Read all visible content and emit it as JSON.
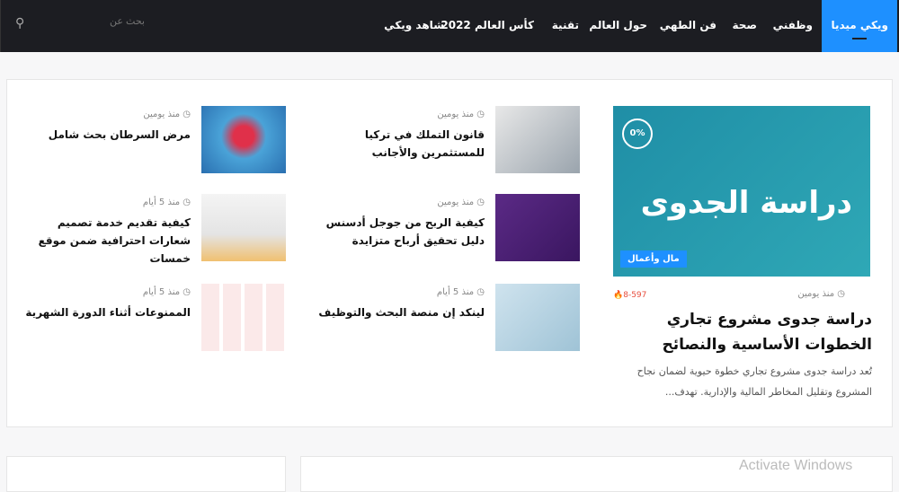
{
  "nav": {
    "items": [
      "ويكي ميديا",
      "وظفني",
      "صحة",
      "فن الطهي",
      "حول العالم",
      "تقنية",
      "كأس العالم 2022",
      "شاهد ويكي"
    ],
    "search_placeholder": "بحث عن"
  },
  "featured": {
    "image_text": "دراسة الجدوى",
    "percent": "0%",
    "category": "مال وأعمال",
    "time": "منذ يومين",
    "views": "8-597",
    "title": "دراسة جدوى مشروع تجاري الخطوات الأساسية والنصائح",
    "excerpt": "تُعد دراسة جدوى مشروع تجاري خطوة حيوية لضمان نجاح المشروع وتقليل المخاطر المالية والإدارية. تهدف..."
  },
  "middle": [
    {
      "time": "منذ يومين",
      "title": "قانون التملك في تركيا للمستثمرين والأجانب"
    },
    {
      "time": "منذ يومين",
      "title": "كيفية الربح من جوجل أدسنس دليل تحقيق أرباح متزايدة"
    },
    {
      "time": "منذ 5 أيام",
      "title": "لينكد إن منصة البحث والتوظيف"
    }
  ],
  "left": [
    {
      "time": "منذ يومين",
      "title": "مرض السرطان بحث شامل"
    },
    {
      "time": "منذ 5 أيام",
      "title": "كيفية تقديم خدمة تصميم شعارات احترافية ضمن موقع خمسات"
    },
    {
      "time": "منذ 5 أيام",
      "title": "الممنوعات أثناء الدورة الشهرية"
    }
  ],
  "watermark": "Activate Windows",
  "colors": {
    "accent": "#1e90ff",
    "nav_bg": "#1c1d22",
    "views": "#e74c3c"
  }
}
